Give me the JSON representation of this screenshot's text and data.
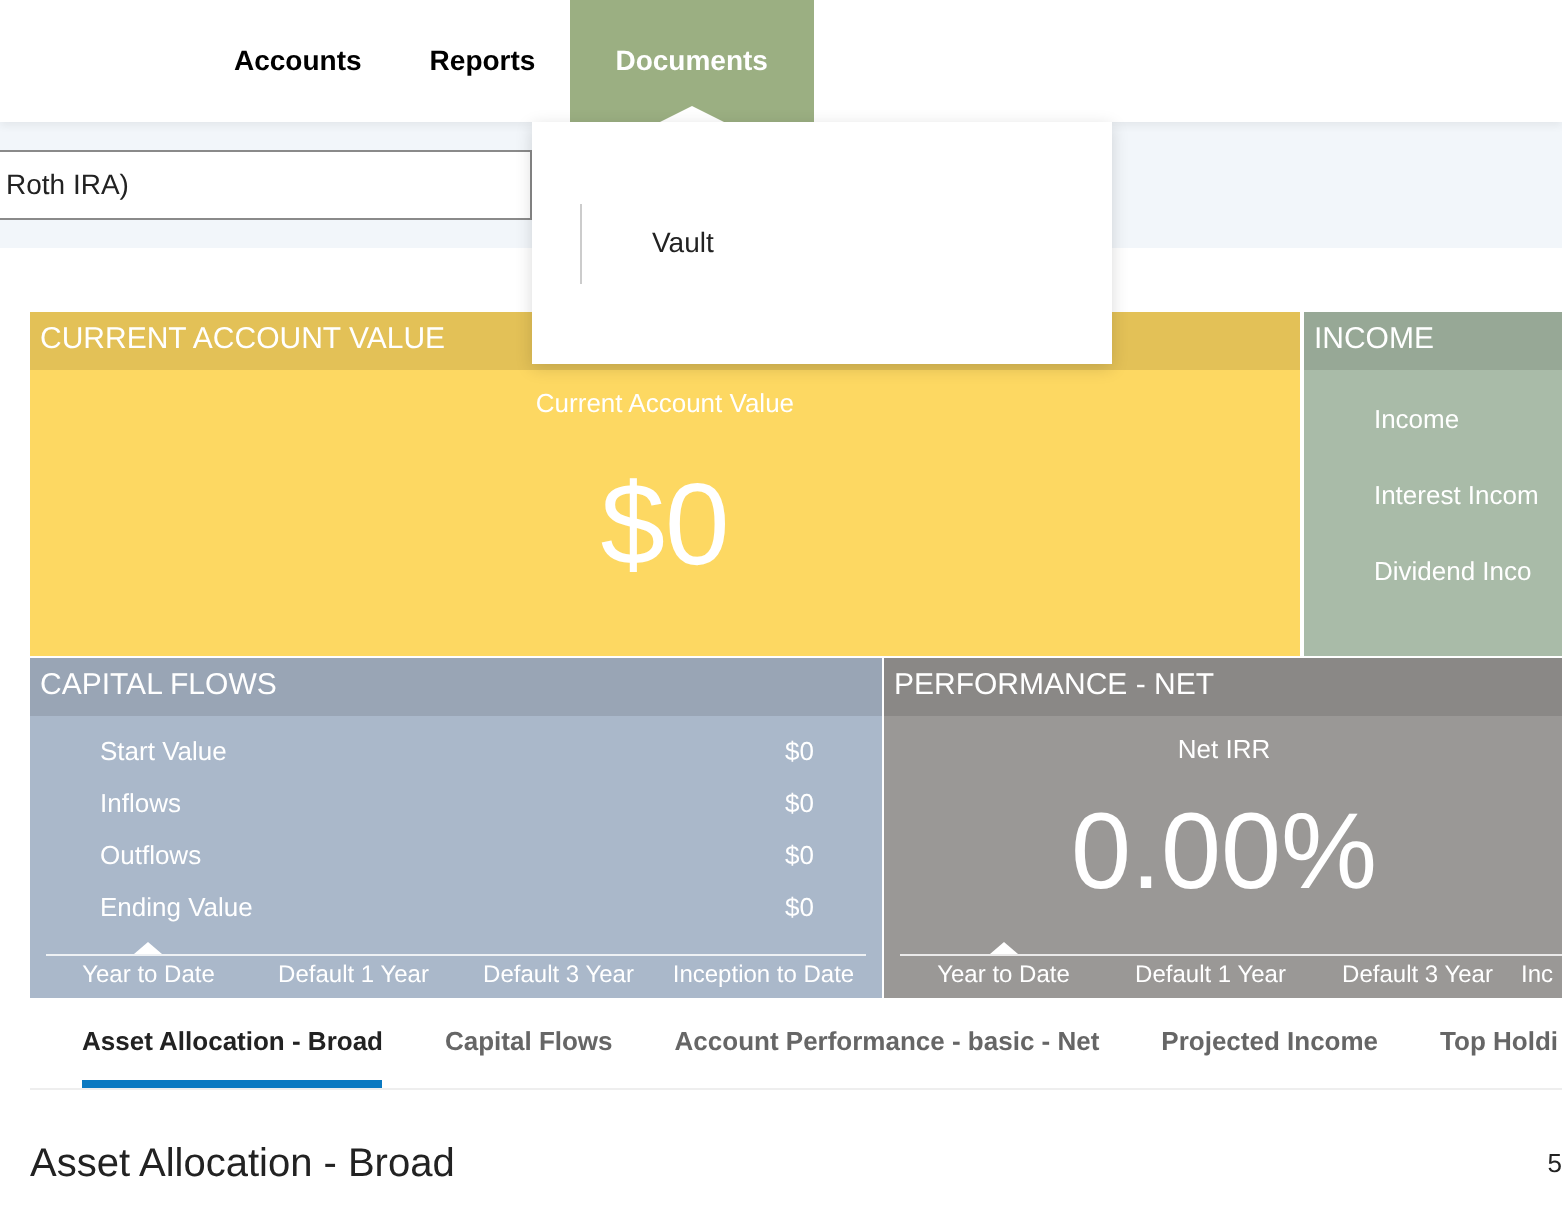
{
  "nav": {
    "items": [
      {
        "label": "Accounts",
        "selected": false
      },
      {
        "label": "Reports",
        "selected": false
      },
      {
        "label": "Documents",
        "selected": true
      }
    ]
  },
  "account_field": {
    "value": "Roth IRA)"
  },
  "documents_menu": {
    "items": [
      "Vault"
    ]
  },
  "current_value": {
    "title": "CURRENT ACCOUNT VALUE",
    "label": "Current Account Value",
    "value": "$0"
  },
  "income": {
    "title": "INCOME",
    "rows": [
      "Income",
      "Interest Incom",
      "Dividend Inco"
    ]
  },
  "capital_flows": {
    "title": "CAPITAL FLOWS",
    "rows": [
      {
        "label": "Start Value",
        "value": "$0"
      },
      {
        "label": "Inflows",
        "value": "$0"
      },
      {
        "label": "Outflows",
        "value": "$0"
      },
      {
        "label": "Ending Value",
        "value": "$0"
      }
    ],
    "periods": [
      {
        "label": "Year to Date",
        "selected": true
      },
      {
        "label": "Default 1 Year",
        "selected": false
      },
      {
        "label": "Default 3 Year",
        "selected": false
      },
      {
        "label": "Inception to Date",
        "selected": false
      }
    ]
  },
  "performance": {
    "title": "PERFORMANCE - NET",
    "label": "Net IRR",
    "value": "0.00%",
    "periods": [
      {
        "label": "Year to Date",
        "selected": true
      },
      {
        "label": "Default 1 Year",
        "selected": false
      },
      {
        "label": "Default 3 Year",
        "selected": false
      },
      {
        "label": "Inc",
        "selected": false
      }
    ]
  },
  "report_tabs": [
    {
      "label": "Asset Allocation - Broad",
      "selected": true
    },
    {
      "label": "Capital Flows",
      "selected": false
    },
    {
      "label": "Account Performance - basic - Net",
      "selected": false
    },
    {
      "label": "Projected Income",
      "selected": false
    },
    {
      "label": "Top Holdi",
      "selected": false
    }
  ],
  "section": {
    "title": "Asset Allocation - Broad",
    "column_2": "5"
  }
}
